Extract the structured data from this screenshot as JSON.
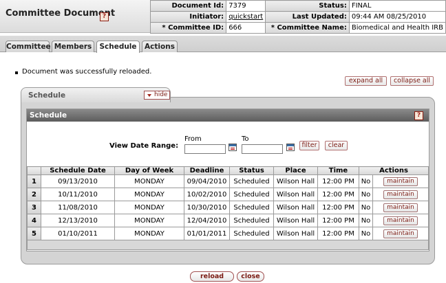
{
  "header": {
    "title": "Committee Document",
    "help_glyph": "?",
    "document_id_label": "Document Id:",
    "document_id": "7379",
    "status_label": "Status:",
    "status": "FINAL",
    "initiator_label": "Initiator:",
    "initiator": "quickstart",
    "last_updated_label": "Last Updated:",
    "last_updated": "09:44 AM 08/25/2010",
    "committee_id_label": "* Committee ID:",
    "committee_id": "666",
    "committee_name_label": "* Committee Name:",
    "committee_name": "Biomedical and Health IRB"
  },
  "tabs": [
    {
      "label": "Committee",
      "active": false
    },
    {
      "label": "Members",
      "active": false
    },
    {
      "label": "Schedule",
      "active": true
    },
    {
      "label": "Actions",
      "active": false
    }
  ],
  "messages": {
    "success": "Document was successfully reloaded."
  },
  "toolbar": {
    "expand_all": "expand all",
    "collapse_all": "collapse all"
  },
  "section": {
    "tab_label": "Schedule",
    "hide_label": "hide",
    "inner_title": "Schedule",
    "view_date_range_label": "View Date Range:",
    "from_label": "From",
    "to_label": "To",
    "from_value": "",
    "to_value": "",
    "filter_label": "filter",
    "clear_label": "clear"
  },
  "schedule_table": {
    "columns": [
      "",
      "Schedule Date",
      "Day of Week",
      "Deadline",
      "Status",
      "Place",
      "Time",
      "Actions"
    ],
    "maintain_label": "maintain",
    "rows": [
      {
        "num": "1",
        "date": "09/13/2010",
        "day": "MONDAY",
        "deadline": "09/04/2010",
        "status": "Scheduled",
        "place": "Wilson Hall",
        "time": "12:00 PM",
        "flag": "No"
      },
      {
        "num": "2",
        "date": "10/11/2010",
        "day": "MONDAY",
        "deadline": "10/02/2010",
        "status": "Scheduled",
        "place": "Wilson Hall",
        "time": "12:00 PM",
        "flag": "No"
      },
      {
        "num": "3",
        "date": "11/08/2010",
        "day": "MONDAY",
        "deadline": "10/30/2010",
        "status": "Scheduled",
        "place": "Wilson Hall",
        "time": "12:00 PM",
        "flag": "No"
      },
      {
        "num": "4",
        "date": "12/13/2010",
        "day": "MONDAY",
        "deadline": "12/04/2010",
        "status": "Scheduled",
        "place": "Wilson Hall",
        "time": "12:00 PM",
        "flag": "No"
      },
      {
        "num": "5",
        "date": "01/10/2011",
        "day": "MONDAY",
        "deadline": "01/01/2011",
        "status": "Scheduled",
        "place": "Wilson Hall",
        "time": "12:00 PM",
        "flag": "No"
      }
    ]
  },
  "footer": {
    "reload_label": "reload",
    "close_label": "close"
  },
  "icons": {
    "help": "help-icon",
    "calendar": "calendar-icon",
    "hide_arrow": "triangle-down-icon"
  },
  "colors": {
    "button_text": "#7a1a12",
    "header_bar": "#5c5c5c",
    "panel_gray": "#d4d4d4"
  }
}
